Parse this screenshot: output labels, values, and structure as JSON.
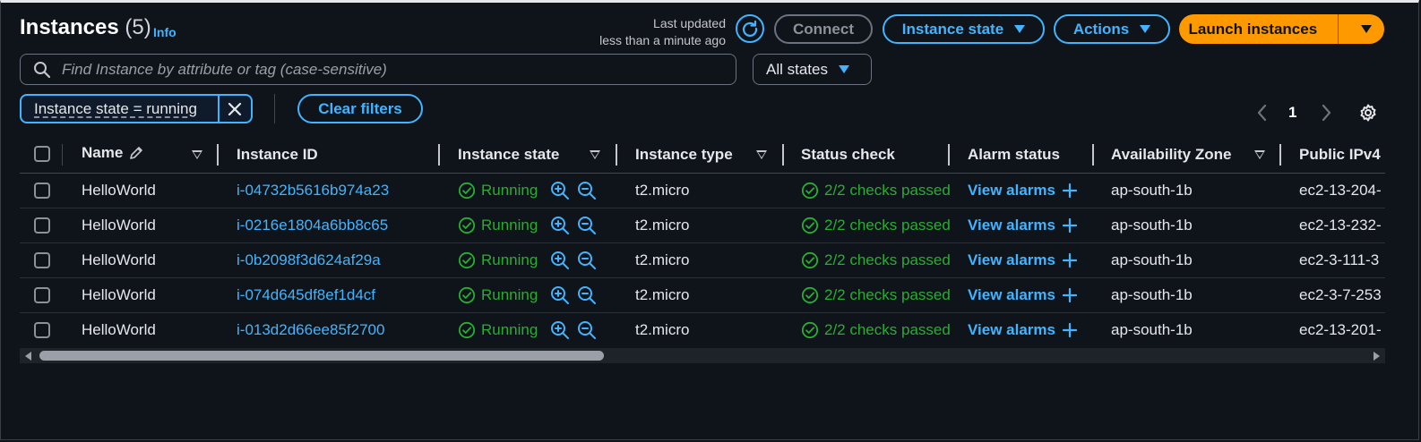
{
  "header": {
    "title": "Instances",
    "count": "(5)",
    "info_link": "Info",
    "last_updated_line1": "Last updated",
    "last_updated_line2": "less than a minute ago",
    "connect_label": "Connect",
    "instance_state_label": "Instance state",
    "actions_label": "Actions",
    "launch_label": "Launch instances"
  },
  "search": {
    "placeholder": "Find Instance by attribute or tag (case-sensitive)"
  },
  "states_select": {
    "selected": "All states"
  },
  "filter": {
    "token": "Instance state = running",
    "clear_label": "Clear filters"
  },
  "pagination": {
    "current_page": "1"
  },
  "table": {
    "columns": [
      "Name",
      "Instance ID",
      "Instance state",
      "Instance type",
      "Status check",
      "Alarm status",
      "Availability Zone",
      "Public IPv4"
    ],
    "rows": [
      {
        "name": "HelloWorld",
        "id": "i-04732b5616b974a23",
        "state": "Running",
        "type": "t2.micro",
        "status": "2/2 checks passed",
        "alarm": "View alarms",
        "az": "ap-south-1b",
        "ipv4": "ec2-13-204-"
      },
      {
        "name": "HelloWorld",
        "id": "i-0216e1804a6bb8c65",
        "state": "Running",
        "type": "t2.micro",
        "status": "2/2 checks passed",
        "alarm": "View alarms",
        "az": "ap-south-1b",
        "ipv4": "ec2-13-232-"
      },
      {
        "name": "HelloWorld",
        "id": "i-0b2098f3d624af29a",
        "state": "Running",
        "type": "t2.micro",
        "status": "2/2 checks passed",
        "alarm": "View alarms",
        "az": "ap-south-1b",
        "ipv4": "ec2-3-111-3"
      },
      {
        "name": "HelloWorld",
        "id": "i-074d645df8ef1d4cf",
        "state": "Running",
        "type": "t2.micro",
        "status": "2/2 checks passed",
        "alarm": "View alarms",
        "az": "ap-south-1b",
        "ipv4": "ec2-3-7-253"
      },
      {
        "name": "HelloWorld",
        "id": "i-013d2d66ee85f2700",
        "state": "Running",
        "type": "t2.micro",
        "status": "2/2 checks passed",
        "alarm": "View alarms",
        "az": "ap-south-1b",
        "ipv4": "ec2-13-201-"
      }
    ]
  },
  "colors": {
    "accent": "#42b4ff",
    "launch": "#ff9900",
    "success": "#29ad32",
    "background": "#0f141a"
  },
  "icons": [
    "refresh-icon",
    "search-icon",
    "close-icon",
    "chevron-left-icon",
    "chevron-right-icon",
    "gear-icon",
    "edit-icon",
    "check-circle-icon",
    "zoom-in-icon",
    "zoom-out-icon",
    "plus-icon"
  ]
}
